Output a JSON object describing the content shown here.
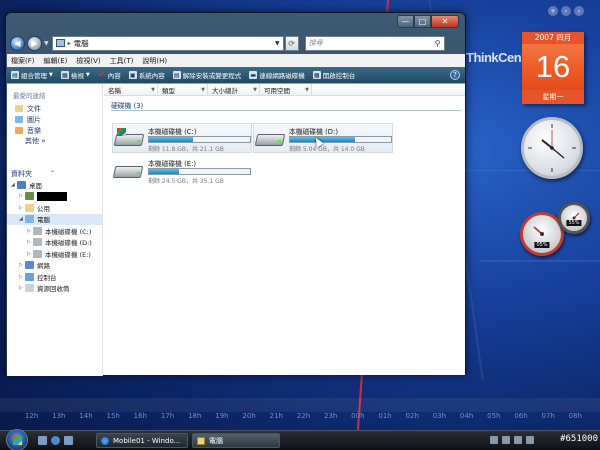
{
  "desktop": {
    "brand": "ThinkCen",
    "timeline_ticks": [
      "12h",
      "13h",
      "14h",
      "15h",
      "16h",
      "17h",
      "18h",
      "19h",
      "20h",
      "21h",
      "22h",
      "23h",
      "00h",
      "01h",
      "02h",
      "03h",
      "04h",
      "05h",
      "06h",
      "07h",
      "08h"
    ]
  },
  "window": {
    "address": "電腦",
    "search_placeholder": "搜尋",
    "controls": {
      "minimize": "—",
      "maximize": "□",
      "close": "✕"
    },
    "menu": [
      "檔案(F)",
      "編輯(E)",
      "檢視(V)",
      "工具(T)",
      "說明(H)"
    ],
    "toolbar": [
      {
        "label": "組合管理",
        "icon": "organize-icon",
        "dropdown": true
      },
      {
        "label": "檢視",
        "icon": "views-icon",
        "dropdown": true
      },
      {
        "label": "內容",
        "icon": "properties-icon",
        "dropdown": false
      },
      {
        "label": "系統內容",
        "icon": "system-properties-icon",
        "dropdown": false
      },
      {
        "label": "解除安裝或變更程式",
        "icon": "uninstall-icon",
        "dropdown": false
      },
      {
        "label": "連線網路磁碟機",
        "icon": "map-drive-icon",
        "dropdown": false
      },
      {
        "label": "開啟控制台",
        "icon": "control-panel-icon",
        "dropdown": false
      }
    ],
    "left_pane": {
      "favorites_title": "最愛的連結",
      "favorites": [
        "文件",
        "圖片",
        "音樂"
      ],
      "more": "其他 »",
      "folders_title": "資料夾",
      "tree": [
        {
          "label": "桌面",
          "level": 0,
          "expanded": true,
          "icon": "desktop-icon"
        },
        {
          "label": "",
          "level": 1,
          "expanded": false,
          "icon": "user-icon",
          "redacted": true
        },
        {
          "label": "公用",
          "level": 1,
          "expanded": false,
          "icon": "public-folder-icon"
        },
        {
          "label": "電腦",
          "level": 1,
          "expanded": true,
          "icon": "computer-icon",
          "selected": true
        },
        {
          "label": "本機磁碟機 (C:)",
          "level": 2,
          "expanded": false,
          "icon": "drive-icon"
        },
        {
          "label": "本機磁碟機 (D:)",
          "level": 2,
          "expanded": false,
          "icon": "drive-icon"
        },
        {
          "label": "本機磁碟機 (E:)",
          "level": 2,
          "expanded": false,
          "icon": "drive-icon"
        },
        {
          "label": "網路",
          "level": 1,
          "expanded": false,
          "icon": "network-icon"
        },
        {
          "label": "控制台",
          "level": 1,
          "expanded": false,
          "icon": "control-panel-icon"
        },
        {
          "label": "資源回收筒",
          "level": 1,
          "expanded": false,
          "icon": "recycle-bin-icon"
        }
      ]
    },
    "columns": [
      "名稱",
      "類型",
      "大小總計",
      "可用空間"
    ],
    "group_label": "硬碟機 (3)",
    "drives": [
      {
        "name": "本機磁碟機 (C:)",
        "free_text": "剩餘 11.8 GB，共 21.1 GB",
        "used_fraction": 0.44,
        "system": true,
        "selected": true
      },
      {
        "name": "本機磁碟機 (D:)",
        "free_text": "剩餘 5.04 GB，共 14.0 GB",
        "used_fraction": 0.64,
        "system": false,
        "selected": true
      },
      {
        "name": "本機磁碟機 (E:)",
        "free_text": "剩餘 24.5 GB，共 35.1 GB",
        "used_fraction": 0.3,
        "system": false,
        "selected": false
      }
    ]
  },
  "gadgets": {
    "calendar": {
      "month": "2007 四月",
      "day": "16",
      "weekday": "星期一"
    },
    "cpu_meter": "05%",
    "mem_meter": "55%"
  },
  "taskbar": {
    "tasks": [
      {
        "label": "Mobile01 - Windo...",
        "icon": "ie-icon"
      },
      {
        "label": "電腦",
        "icon": "folder-icon"
      }
    ],
    "tag": "#651000"
  }
}
